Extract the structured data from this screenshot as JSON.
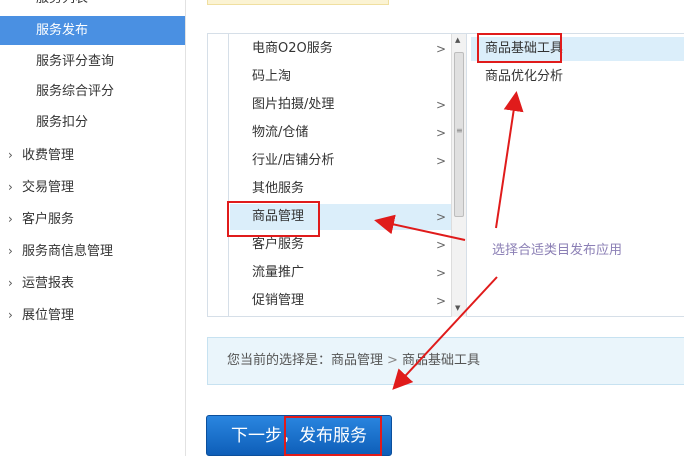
{
  "sidebar": {
    "sub_items": [
      {
        "label": "服务列表",
        "active": false
      },
      {
        "label": "服务发布",
        "active": true
      },
      {
        "label": "服务评分查询",
        "active": false
      },
      {
        "label": "服务综合评分",
        "active": false
      },
      {
        "label": "服务扣分",
        "active": false
      }
    ],
    "groups": [
      "收费管理",
      "交易管理",
      "客户服务",
      "服务商信息管理",
      "运营报表",
      "展位管理"
    ]
  },
  "categories": [
    {
      "label": "电商O2O服务",
      "has_children": true
    },
    {
      "label": "码上淘",
      "has_children": false
    },
    {
      "label": "图片拍摄/处理",
      "has_children": true
    },
    {
      "label": "物流/仓储",
      "has_children": true
    },
    {
      "label": "行业/店铺分析",
      "has_children": true
    },
    {
      "label": "其他服务",
      "has_children": false
    },
    {
      "label": "商品管理",
      "has_children": true,
      "selected": true
    },
    {
      "label": "客户服务",
      "has_children": true
    },
    {
      "label": "流量推广",
      "has_children": true
    },
    {
      "label": "促销管理",
      "has_children": true
    }
  ],
  "tools": [
    {
      "label": "商品基础工具",
      "selected": true
    },
    {
      "label": "商品优化分析",
      "selected": false
    }
  ],
  "choice": {
    "prefix": "您当前的选择是：",
    "category": "商品管理",
    "separator": ">",
    "tool": "商品基础工具"
  },
  "next_button": {
    "label": "下一步，发布服务"
  },
  "annotation": {
    "text": "选择合适类目发布应用"
  },
  "colors": {
    "accent": "#4a90e2",
    "selected_bg": "#dbeefa",
    "annotation_red": "#e01b1b",
    "button_blue": "#1a73cf"
  }
}
